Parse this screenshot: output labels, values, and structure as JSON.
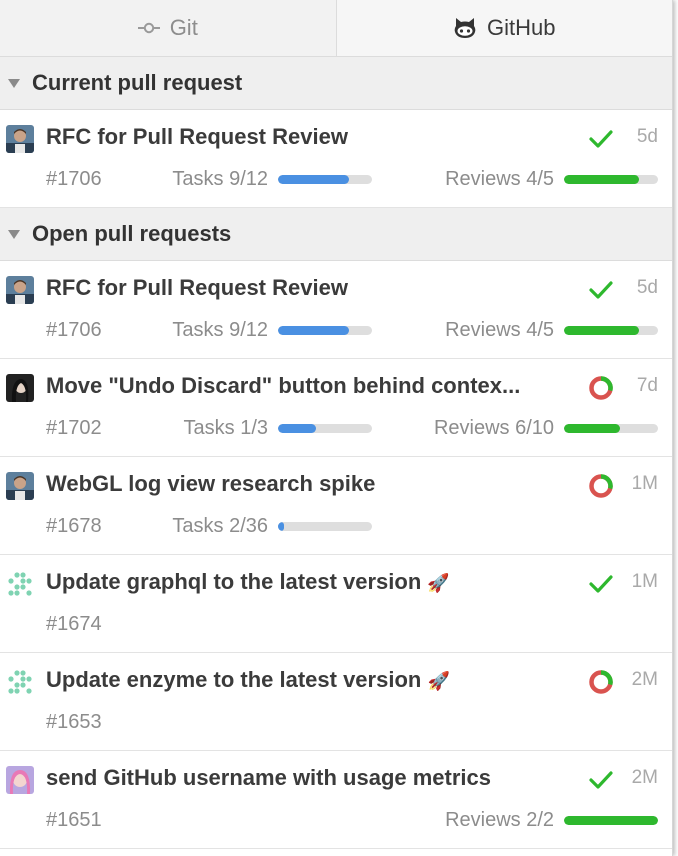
{
  "colors": {
    "tasks_bar": "#4a90e2",
    "reviews_bar": "#2eb82e",
    "check": "#2eb82e",
    "pending_ring_red": "#d9534f",
    "pending_ring_green": "#2eb82e"
  },
  "tabs": [
    {
      "label": "Git",
      "icon": "git-commit-icon",
      "active": false
    },
    {
      "label": "GitHub",
      "icon": "octocat-icon",
      "active": true
    }
  ],
  "current_section": {
    "title": "Current pull request",
    "items": [
      {
        "avatar": "avatar-man",
        "title": "RFC for Pull Request Review",
        "status": "success",
        "age": "5d",
        "number": "#1706",
        "tasks_label": "Tasks 9/12",
        "tasks_progress": 0.75,
        "reviews_label": "Reviews 4/5",
        "reviews_progress": 0.8
      }
    ]
  },
  "open_section": {
    "title": "Open pull requests",
    "items": [
      {
        "avatar": "avatar-man",
        "title": "RFC for Pull Request Review",
        "status": "success",
        "age": "5d",
        "number": "#1706",
        "tasks_label": "Tasks 9/12",
        "tasks_progress": 0.75,
        "reviews_label": "Reviews 4/5",
        "reviews_progress": 0.8
      },
      {
        "avatar": "avatar-woman",
        "title": "Move \"Undo Discard\" button behind contex...",
        "status": "pending",
        "age": "7d",
        "number": "#1702",
        "tasks_label": "Tasks 1/3",
        "tasks_progress": 0.4,
        "reviews_label": "Reviews 6/10",
        "reviews_progress": 0.6
      },
      {
        "avatar": "avatar-man",
        "title": "WebGL log view research spike",
        "status": "pending",
        "age": "1M",
        "number": "#1678",
        "tasks_label": "Tasks 2/36",
        "tasks_progress": 0.06
      },
      {
        "avatar": "avatar-identicon",
        "title": "Update graphql to the latest version",
        "rocket": "🚀",
        "status": "success",
        "age": "1M",
        "number": "#1674"
      },
      {
        "avatar": "avatar-identicon",
        "title": "Update enzyme to the latest version",
        "rocket": "🚀",
        "status": "pending",
        "age": "2M",
        "number": "#1653"
      },
      {
        "avatar": "avatar-pink",
        "title": "send GitHub username with usage metrics",
        "status": "success",
        "age": "2M",
        "number": "#1651",
        "reviews_label": "Reviews 2/2",
        "reviews_progress": 1.0
      }
    ]
  }
}
